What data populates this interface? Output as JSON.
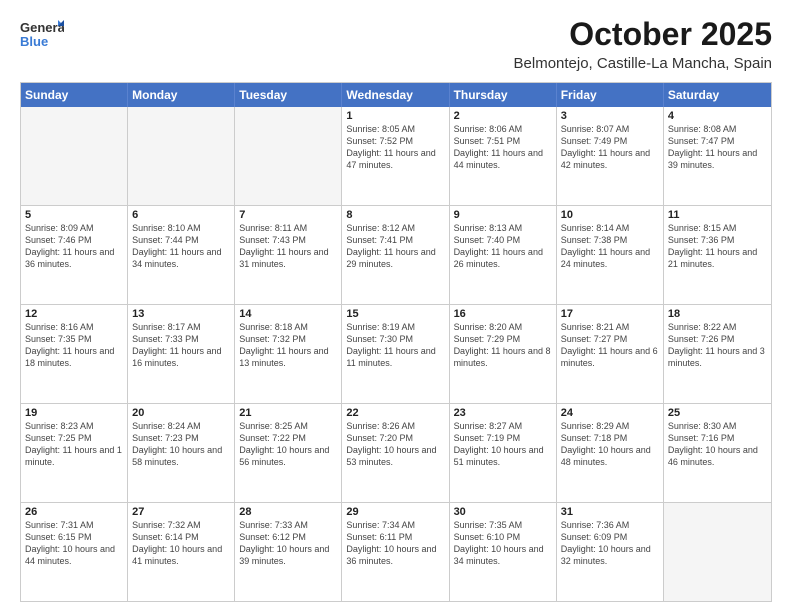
{
  "header": {
    "logo_general": "General",
    "logo_blue": "Blue",
    "month_title": "October 2025",
    "subtitle": "Belmontejo, Castille-La Mancha, Spain"
  },
  "day_headers": [
    "Sunday",
    "Monday",
    "Tuesday",
    "Wednesday",
    "Thursday",
    "Friday",
    "Saturday"
  ],
  "weeks": [
    [
      {
        "day": "",
        "empty": true,
        "info": ""
      },
      {
        "day": "",
        "empty": true,
        "info": ""
      },
      {
        "day": "",
        "empty": true,
        "info": ""
      },
      {
        "day": "1",
        "empty": false,
        "info": "Sunrise: 8:05 AM\nSunset: 7:52 PM\nDaylight: 11 hours\nand 47 minutes."
      },
      {
        "day": "2",
        "empty": false,
        "info": "Sunrise: 8:06 AM\nSunset: 7:51 PM\nDaylight: 11 hours\nand 44 minutes."
      },
      {
        "day": "3",
        "empty": false,
        "info": "Sunrise: 8:07 AM\nSunset: 7:49 PM\nDaylight: 11 hours\nand 42 minutes."
      },
      {
        "day": "4",
        "empty": false,
        "info": "Sunrise: 8:08 AM\nSunset: 7:47 PM\nDaylight: 11 hours\nand 39 minutes."
      }
    ],
    [
      {
        "day": "5",
        "empty": false,
        "info": "Sunrise: 8:09 AM\nSunset: 7:46 PM\nDaylight: 11 hours\nand 36 minutes."
      },
      {
        "day": "6",
        "empty": false,
        "info": "Sunrise: 8:10 AM\nSunset: 7:44 PM\nDaylight: 11 hours\nand 34 minutes."
      },
      {
        "day": "7",
        "empty": false,
        "info": "Sunrise: 8:11 AM\nSunset: 7:43 PM\nDaylight: 11 hours\nand 31 minutes."
      },
      {
        "day": "8",
        "empty": false,
        "info": "Sunrise: 8:12 AM\nSunset: 7:41 PM\nDaylight: 11 hours\nand 29 minutes."
      },
      {
        "day": "9",
        "empty": false,
        "info": "Sunrise: 8:13 AM\nSunset: 7:40 PM\nDaylight: 11 hours\nand 26 minutes."
      },
      {
        "day": "10",
        "empty": false,
        "info": "Sunrise: 8:14 AM\nSunset: 7:38 PM\nDaylight: 11 hours\nand 24 minutes."
      },
      {
        "day": "11",
        "empty": false,
        "info": "Sunrise: 8:15 AM\nSunset: 7:36 PM\nDaylight: 11 hours\nand 21 minutes."
      }
    ],
    [
      {
        "day": "12",
        "empty": false,
        "info": "Sunrise: 8:16 AM\nSunset: 7:35 PM\nDaylight: 11 hours\nand 18 minutes."
      },
      {
        "day": "13",
        "empty": false,
        "info": "Sunrise: 8:17 AM\nSunset: 7:33 PM\nDaylight: 11 hours\nand 16 minutes."
      },
      {
        "day": "14",
        "empty": false,
        "info": "Sunrise: 8:18 AM\nSunset: 7:32 PM\nDaylight: 11 hours\nand 13 minutes."
      },
      {
        "day": "15",
        "empty": false,
        "info": "Sunrise: 8:19 AM\nSunset: 7:30 PM\nDaylight: 11 hours\nand 11 minutes."
      },
      {
        "day": "16",
        "empty": false,
        "info": "Sunrise: 8:20 AM\nSunset: 7:29 PM\nDaylight: 11 hours\nand 8 minutes."
      },
      {
        "day": "17",
        "empty": false,
        "info": "Sunrise: 8:21 AM\nSunset: 7:27 PM\nDaylight: 11 hours\nand 6 minutes."
      },
      {
        "day": "18",
        "empty": false,
        "info": "Sunrise: 8:22 AM\nSunset: 7:26 PM\nDaylight: 11 hours\nand 3 minutes."
      }
    ],
    [
      {
        "day": "19",
        "empty": false,
        "info": "Sunrise: 8:23 AM\nSunset: 7:25 PM\nDaylight: 11 hours\nand 1 minute."
      },
      {
        "day": "20",
        "empty": false,
        "info": "Sunrise: 8:24 AM\nSunset: 7:23 PM\nDaylight: 10 hours\nand 58 minutes."
      },
      {
        "day": "21",
        "empty": false,
        "info": "Sunrise: 8:25 AM\nSunset: 7:22 PM\nDaylight: 10 hours\nand 56 minutes."
      },
      {
        "day": "22",
        "empty": false,
        "info": "Sunrise: 8:26 AM\nSunset: 7:20 PM\nDaylight: 10 hours\nand 53 minutes."
      },
      {
        "day": "23",
        "empty": false,
        "info": "Sunrise: 8:27 AM\nSunset: 7:19 PM\nDaylight: 10 hours\nand 51 minutes."
      },
      {
        "day": "24",
        "empty": false,
        "info": "Sunrise: 8:29 AM\nSunset: 7:18 PM\nDaylight: 10 hours\nand 48 minutes."
      },
      {
        "day": "25",
        "empty": false,
        "info": "Sunrise: 8:30 AM\nSunset: 7:16 PM\nDaylight: 10 hours\nand 46 minutes."
      }
    ],
    [
      {
        "day": "26",
        "empty": false,
        "info": "Sunrise: 7:31 AM\nSunset: 6:15 PM\nDaylight: 10 hours\nand 44 minutes."
      },
      {
        "day": "27",
        "empty": false,
        "info": "Sunrise: 7:32 AM\nSunset: 6:14 PM\nDaylight: 10 hours\nand 41 minutes."
      },
      {
        "day": "28",
        "empty": false,
        "info": "Sunrise: 7:33 AM\nSunset: 6:12 PM\nDaylight: 10 hours\nand 39 minutes."
      },
      {
        "day": "29",
        "empty": false,
        "info": "Sunrise: 7:34 AM\nSunset: 6:11 PM\nDaylight: 10 hours\nand 36 minutes."
      },
      {
        "day": "30",
        "empty": false,
        "info": "Sunrise: 7:35 AM\nSunset: 6:10 PM\nDaylight: 10 hours\nand 34 minutes."
      },
      {
        "day": "31",
        "empty": false,
        "info": "Sunrise: 7:36 AM\nSunset: 6:09 PM\nDaylight: 10 hours\nand 32 minutes."
      },
      {
        "day": "",
        "empty": true,
        "info": ""
      }
    ]
  ]
}
